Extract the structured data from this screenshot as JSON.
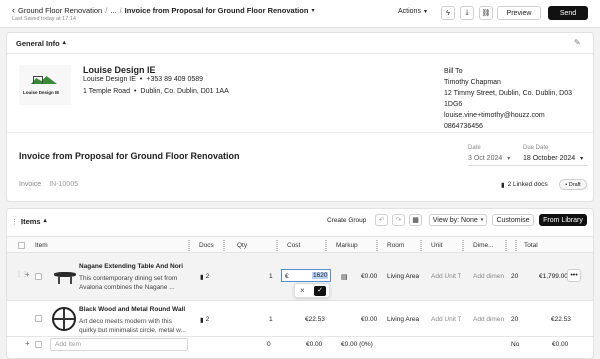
{
  "header": {
    "breadcrumb_back": "‹",
    "breadcrumb_project": "Ground Floor Renovation",
    "breadcrumb_sep1": "/",
    "breadcrumb_ellipsis": "...",
    "breadcrumb_sep2": "/",
    "breadcrumb_current": "Invoice from Proposal for Ground Floor Renovation",
    "last_saved": "Last Saved today at 17:14",
    "actions_label": "Actions",
    "preview_label": "Preview",
    "send_label": "Send"
  },
  "general_info": {
    "title": "General Info",
    "company_name": "Louise Design IE",
    "company_line": "Louise Design IE",
    "company_phone": "+353 89 409 0589",
    "company_address1": "1 Temple Road",
    "company_address2": "Dublin, Co. Dublin, D01 1AA",
    "logo_text": "Louise Design IE",
    "bill_to_label": "Bill To",
    "bill_to_name": "Timothy Chapman",
    "bill_to_address1": "12 Timmy Street, Dublin, Co. Dublin, D03",
    "bill_to_address2": "1DG6",
    "bill_to_email": "louise.vine+timothy@houzz.com",
    "bill_to_phone": "0864736456",
    "invoice_title": "Invoice from Proposal for Ground Floor Renovation",
    "date_label": "Date",
    "date_value": "3 Oct 2024",
    "due_label": "Due Date",
    "due_value": "18 October 2024",
    "invoice_label": "Invoice",
    "invoice_number": "IN-10005",
    "linked_docs": "2 Linked docs",
    "status": "Draft"
  },
  "items": {
    "title": "Items",
    "create_group": "Create Group",
    "view_by": "View by: None",
    "customise": "Customise",
    "from_library": "From Library",
    "columns": [
      "Item",
      "Docs",
      "Qty",
      "Cost",
      "Markup",
      "Room",
      "Unit",
      "Dime...",
      "",
      "Total"
    ],
    "rows": [
      {
        "name": "Nagane Extending Table And Nori F...",
        "desc1": "This contemporary dining set from",
        "desc2": "Avalona combines the Nagane ...",
        "docs": "2",
        "qty": "1",
        "cost_prefix": "€",
        "cost_value": "1620",
        "markup": "€0.00",
        "room": "Living Area",
        "unit": "Add Unit Ty...",
        "dim": "Add dimen...",
        "extra": "20",
        "total": "€1,799.00"
      },
      {
        "name": "Black Wood and Metal Round Wall S...",
        "desc1": "Art deco meets modern with this",
        "desc2": "quirky but minimalist circle, metal w...",
        "docs": "2",
        "qty": "1",
        "cost": "€22.53",
        "markup": "€0.00",
        "room": "Living Area",
        "unit": "Add Unit Ty...",
        "dim": "Add dimen...",
        "extra": "20",
        "total": "€22.53"
      }
    ],
    "add_item_placeholder": "Add Item",
    "footer": {
      "qty": "0",
      "cost": "€0.00",
      "markup": "€0.00 (0%)",
      "extra": "No",
      "total": "€0.00"
    }
  }
}
